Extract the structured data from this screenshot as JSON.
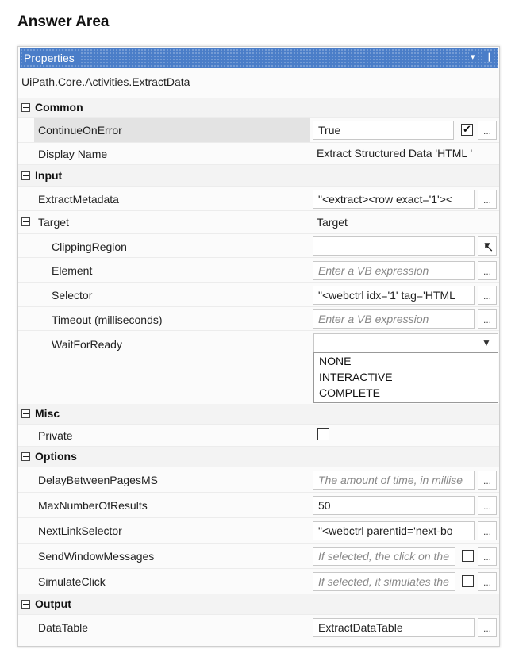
{
  "heading": "Answer Area",
  "panel": {
    "title": "Properties",
    "pin_glyph": "▾",
    "pin_glyph2": "❙",
    "class_name": "UiPath.Core.Activities.ExtractData"
  },
  "categories": {
    "common": "Common",
    "input": "Input",
    "misc": "Misc",
    "options": "Options",
    "output": "Output"
  },
  "props": {
    "continue_on_error": {
      "label": "ContinueOnError",
      "value": "True"
    },
    "display_name": {
      "label": "Display Name",
      "value": "Extract Structured Data 'HTML '"
    },
    "extract_metadata": {
      "label": "ExtractMetadata",
      "value": "\"<extract><row exact='1'><"
    },
    "target": {
      "label": "Target",
      "value": "Target"
    },
    "clipping_region": {
      "label": "ClippingRegion",
      "value": ""
    },
    "element": {
      "label": "Element",
      "placeholder": "Enter a VB expression"
    },
    "selector": {
      "label": "Selector",
      "value": "\"<webctrl idx='1' tag='HTML"
    },
    "timeout": {
      "label": "Timeout (milliseconds)",
      "placeholder": "Enter a VB expression"
    },
    "wait_for_ready": {
      "label": "WaitForReady",
      "value": "",
      "options": [
        "NONE",
        "INTERACTIVE",
        "COMPLETE"
      ]
    },
    "private": {
      "label": "Private"
    },
    "delay_between_pages": {
      "label": "DelayBetweenPagesMS",
      "placeholder": "The amount of time, in millise"
    },
    "max_number_of_results": {
      "label": "MaxNumberOfResults",
      "value": "50"
    },
    "next_link_selector": {
      "label": "NextLinkSelector",
      "value": "\"<webctrl parentid='next-bo"
    },
    "send_window_messages": {
      "label": "SendWindowMessages",
      "placeholder": "If selected, the click on the"
    },
    "simulate_click": {
      "label": "SimulateClick",
      "placeholder": "If selected, it simulates the"
    },
    "data_table": {
      "label": "DataTable",
      "value": "ExtractDataTable"
    }
  },
  "glyphs": {
    "ellipsis": "...",
    "checkmark": "✔",
    "dropdown_arrow": "▼",
    "cursor": "↖"
  },
  "colors": {
    "titlebar": "#4a7dc8",
    "selected_row": "#e3e3e3",
    "category_row": "#f3f3f3"
  }
}
